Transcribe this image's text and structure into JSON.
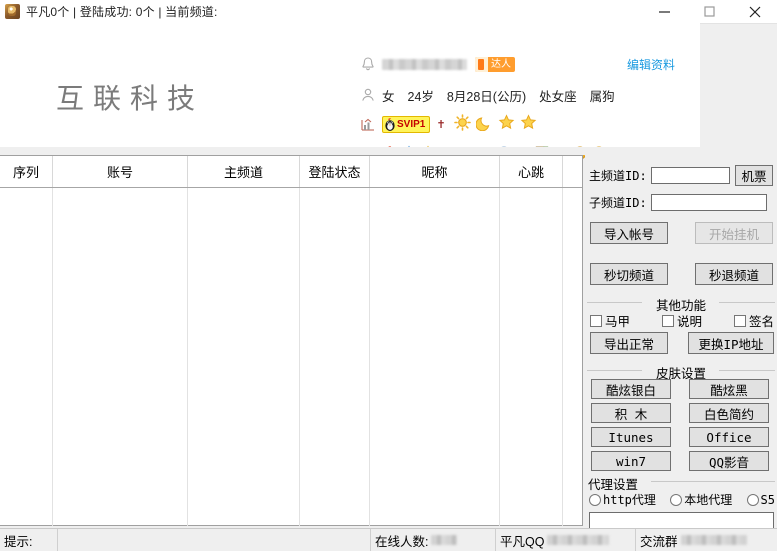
{
  "window": {
    "title": "平凡0个 | 登陆成功: 0个 | 当前频道:",
    "app_icon": "app-logo-icon",
    "minimize": "—",
    "maximize": "□",
    "close": "✕"
  },
  "profile": {
    "logo_text": "互联科技",
    "nickname_masked": "",
    "talent_badge": "达人",
    "edit_link": "编辑资料",
    "info": [
      "女",
      "24岁",
      "8月28日(公历)",
      "处女座",
      "属狗"
    ],
    "level": {
      "svip_label": "SVIP1",
      "dagger": "✝",
      "icons": [
        "sun-icon",
        "moon-icon",
        "star-icon",
        "star-icon"
      ]
    },
    "badges": [
      "shield-outline-icon",
      "qq-penguin-icon",
      "blue-star-icon",
      "gold-star-icon",
      "camera-icon",
      "blue-shield-icon",
      "gift-box-icon",
      "eye-icon",
      "cow-icon",
      "book-icon",
      "mail-icon",
      "yellow-bag-icon",
      "play-icon"
    ],
    "nav_prev": "‹",
    "nav_next": "›"
  },
  "grid": {
    "columns": [
      {
        "label": "序列",
        "width": 53
      },
      {
        "label": "账号",
        "width": 135
      },
      {
        "label": "主频道",
        "width": 112
      },
      {
        "label": "登陆状态",
        "width": 70
      },
      {
        "label": "昵称",
        "width": 130
      },
      {
        "label": "心跳",
        "width": 63
      },
      {
        "label": "",
        "width": 18
      }
    ],
    "rows": []
  },
  "panel": {
    "main_channel_label": "主频道ID:",
    "main_channel_value": "",
    "sub_channel_label": "子频道ID:",
    "sub_channel_value": "",
    "ticket_button": "机票",
    "import_button": "导入帐号",
    "start_button": "开始挂机",
    "start_button_disabled": true,
    "quick_switch_button": "秒切频道",
    "quick_quit_button": "秒退频道",
    "other_group_title": "其他功能",
    "checkboxes": [
      {
        "label": "马甲",
        "checked": false
      },
      {
        "label": "说明",
        "checked": false
      },
      {
        "label": "签名",
        "checked": false
      }
    ],
    "export_button": "导出正常",
    "change_ip_button": "更换IP地址",
    "skin_group_title": "皮肤设置",
    "skin_buttons": [
      "酷炫银白",
      "酷炫黑",
      "积  木",
      "白色简约",
      "Itunes",
      "Office",
      "win7",
      "QQ影音"
    ],
    "proxy_group_title": "代理设置",
    "proxy_options": [
      {
        "label": "http代理",
        "selected": false
      },
      {
        "label": "本地代理",
        "selected": false
      },
      {
        "label": "S5",
        "selected": false
      }
    ],
    "proxy_value": ""
  },
  "statusbar": {
    "hint_label": "提示:",
    "hint_value": "",
    "online_label": "在线人数:",
    "online_value_masked": "",
    "qq_label": "平凡QQ",
    "qq_value_masked": "",
    "group_label": "交流群",
    "group_value_masked": ""
  }
}
